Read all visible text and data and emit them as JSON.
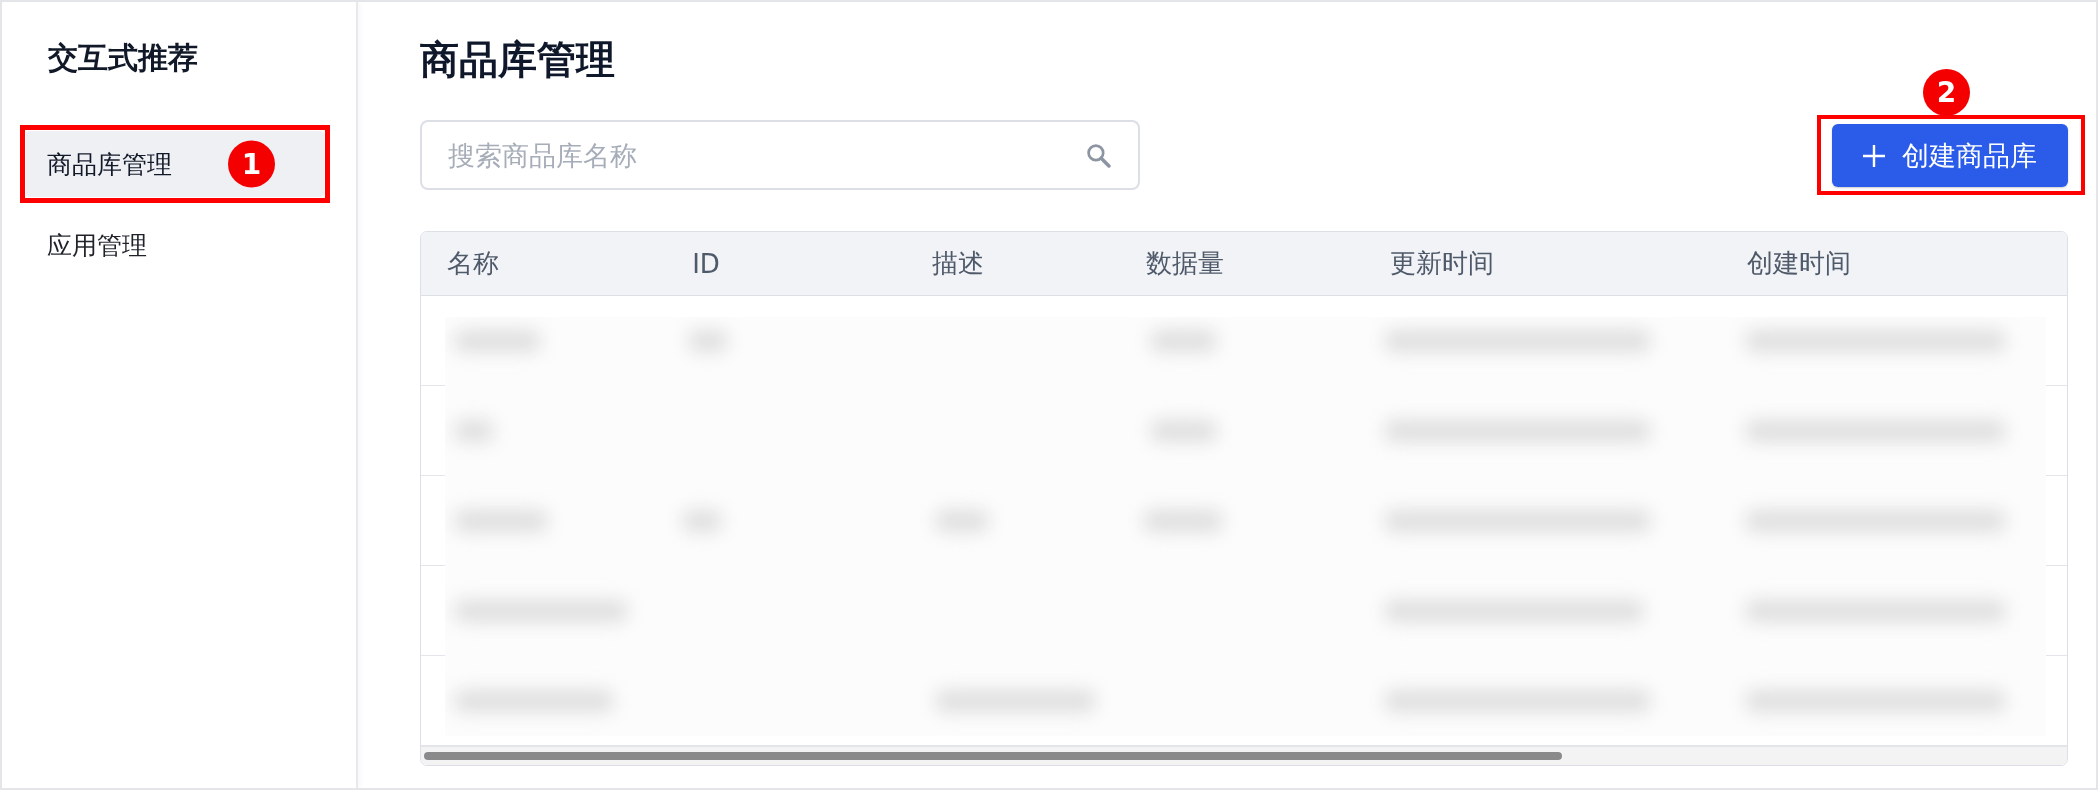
{
  "sidebar": {
    "title": "交互式推荐",
    "items": [
      {
        "label": "商品库管理",
        "selected": true,
        "callout": "1"
      },
      {
        "label": "应用管理",
        "selected": false
      }
    ]
  },
  "main": {
    "title": "商品库管理",
    "search": {
      "placeholder": "搜索商品库名称"
    },
    "create_button": {
      "label": "创建商品库",
      "callout": "2"
    }
  },
  "table": {
    "columns": [
      "名称",
      "ID",
      "描述",
      "数据量",
      "更新时间",
      "创建时间"
    ]
  }
}
